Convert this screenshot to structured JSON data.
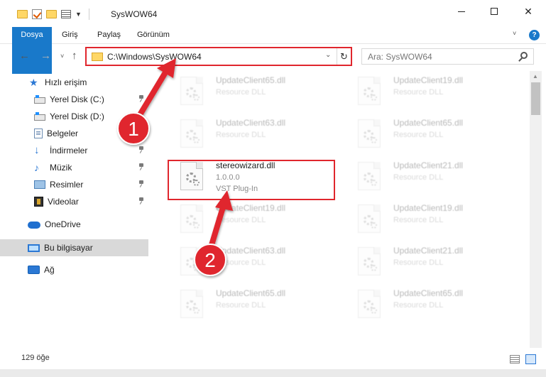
{
  "window": {
    "title": "SysWOW64",
    "minimize_icon": "minimize-icon",
    "maximize_icon": "maximize-icon",
    "close_glyph": "✕"
  },
  "ribbon": {
    "tabs": [
      {
        "label": "Dosya",
        "active": true
      },
      {
        "label": "Giriş"
      },
      {
        "label": "Paylaş"
      },
      {
        "label": "Görünüm"
      }
    ],
    "help_label": "?",
    "accent": "#1979ca"
  },
  "navigation": {
    "back_glyph": "←",
    "forward_glyph": "→",
    "recent_glyph": "˅",
    "up_glyph": "↑",
    "address": "C:\\Windows\\SysWOW64",
    "address_highlight_color": "#e0262d",
    "refresh_glyph": "↻",
    "dropdown_glyph": "⌄",
    "search_placeholder": "Ara: SysWOW64"
  },
  "sidebar": {
    "items": [
      {
        "label": "Hızlı erişim",
        "icon": "star-icon",
        "pinned": false
      },
      {
        "label": "Yerel Disk (C:)",
        "icon": "disk-icon",
        "pinned": true
      },
      {
        "label": "Yerel Disk (D:)",
        "icon": "disk-icon",
        "pinned": false
      },
      {
        "label": "Belgeler",
        "icon": "documents-icon",
        "pinned": false
      },
      {
        "label": "İndirmeler",
        "icon": "download-icon",
        "pinned": true
      },
      {
        "label": "Müzik",
        "icon": "music-icon",
        "pinned": true
      },
      {
        "label": "Resimler",
        "icon": "pictures-icon",
        "pinned": true
      },
      {
        "label": "Videolar",
        "icon": "video-icon",
        "pinned": true
      },
      {
        "label": "OneDrive",
        "icon": "onedrive-icon",
        "pinned": false
      },
      {
        "label": "Bu bilgisayar",
        "icon": "this-pc-icon",
        "pinned": false,
        "selected": true
      },
      {
        "label": "Ağ",
        "icon": "network-icon",
        "pinned": false
      }
    ]
  },
  "files": [
    {
      "name": "UpdateClient65.dll",
      "line1": "Resource DLL",
      "line2": "",
      "faded": true
    },
    {
      "name": "UpdateClient19.dll",
      "line1": "Resource DLL",
      "line2": "",
      "faded": true
    },
    {
      "name": "UpdateClient63.dll",
      "line1": "Resource DLL",
      "line2": "",
      "faded": true
    },
    {
      "name": "UpdateClient65.dll",
      "line1": "Resource DLL",
      "line2": "",
      "faded": true
    },
    {
      "name": "stereowizard.dll",
      "line1": "1.0.0.0",
      "line2": "VST Plug-In",
      "faded": false
    },
    {
      "name": "UpdateClient21.dll",
      "line1": "Resource DLL",
      "line2": "",
      "faded": true
    },
    {
      "name": "UpdateClient19.dll",
      "line1": "Resource DLL",
      "line2": "",
      "faded": true
    },
    {
      "name": "UpdateClient19.dll",
      "line1": "Resource DLL",
      "line2": "",
      "faded": true
    },
    {
      "name": "UpdateClient63.dll",
      "line1": "Resource DLL",
      "line2": "",
      "faded": true
    },
    {
      "name": "UpdateClient21.dll",
      "line1": "Resource DLL",
      "line2": "",
      "faded": true
    },
    {
      "name": "UpdateClient65.dll",
      "line1": "Resource DLL",
      "line2": "",
      "faded": true
    },
    {
      "name": "UpdateClient65.dll",
      "line1": "Resource DLL",
      "line2": "",
      "faded": true
    }
  ],
  "annotations": {
    "step1": "1",
    "step2": "2",
    "color": "#e0262d"
  },
  "status": {
    "count": "129 öğe"
  }
}
